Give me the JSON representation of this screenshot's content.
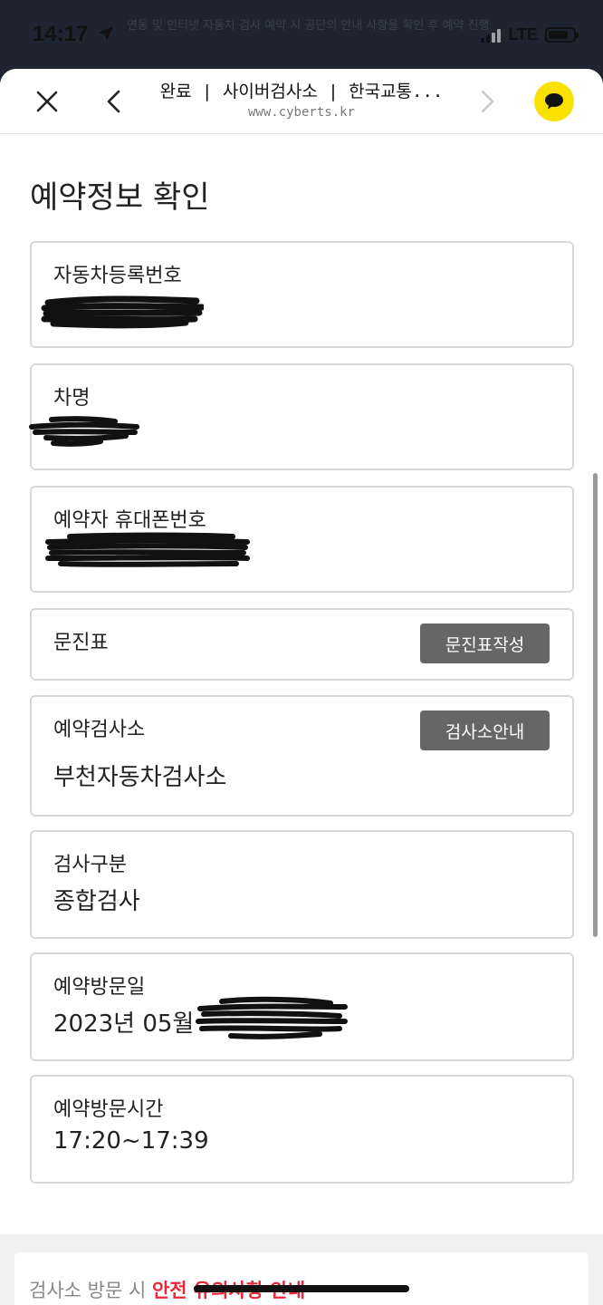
{
  "status_bar": {
    "time": "14:17",
    "network": "LTE"
  },
  "background_text": "연동 및 인터넷 자동차 검사 예약 시 공단의 안내 사항을 확인 후 예약 진행",
  "browser": {
    "title": "완료 | 사이버검사소 | 한국교통...",
    "url": "www.cyberts.kr"
  },
  "page": {
    "title": "예약정보 확인"
  },
  "fields": {
    "car_number": {
      "label": "자동차등록번호"
    },
    "car_name": {
      "label": "차명"
    },
    "phone": {
      "label": "예약자 휴대폰번호"
    },
    "questionnaire": {
      "label": "문진표",
      "button": "문진표작성"
    },
    "center": {
      "label": "예약검사소",
      "value": "부천자동차검사소",
      "button": "검사소안내"
    },
    "inspection_type": {
      "label": "검사구분",
      "value": "종합검사"
    },
    "visit_date": {
      "label": "예약방문일",
      "value": "2023년 05월"
    },
    "visit_time": {
      "label": "예약방문시간",
      "value": "17:20~17:39"
    }
  },
  "notice": {
    "prefix": "검사소 방문 시 ",
    "highlight": "안전 유의사항 안내"
  },
  "colors": {
    "kakao_yellow": "#fae100",
    "button_gray": "#666666",
    "highlight_red": "#e8283b"
  }
}
